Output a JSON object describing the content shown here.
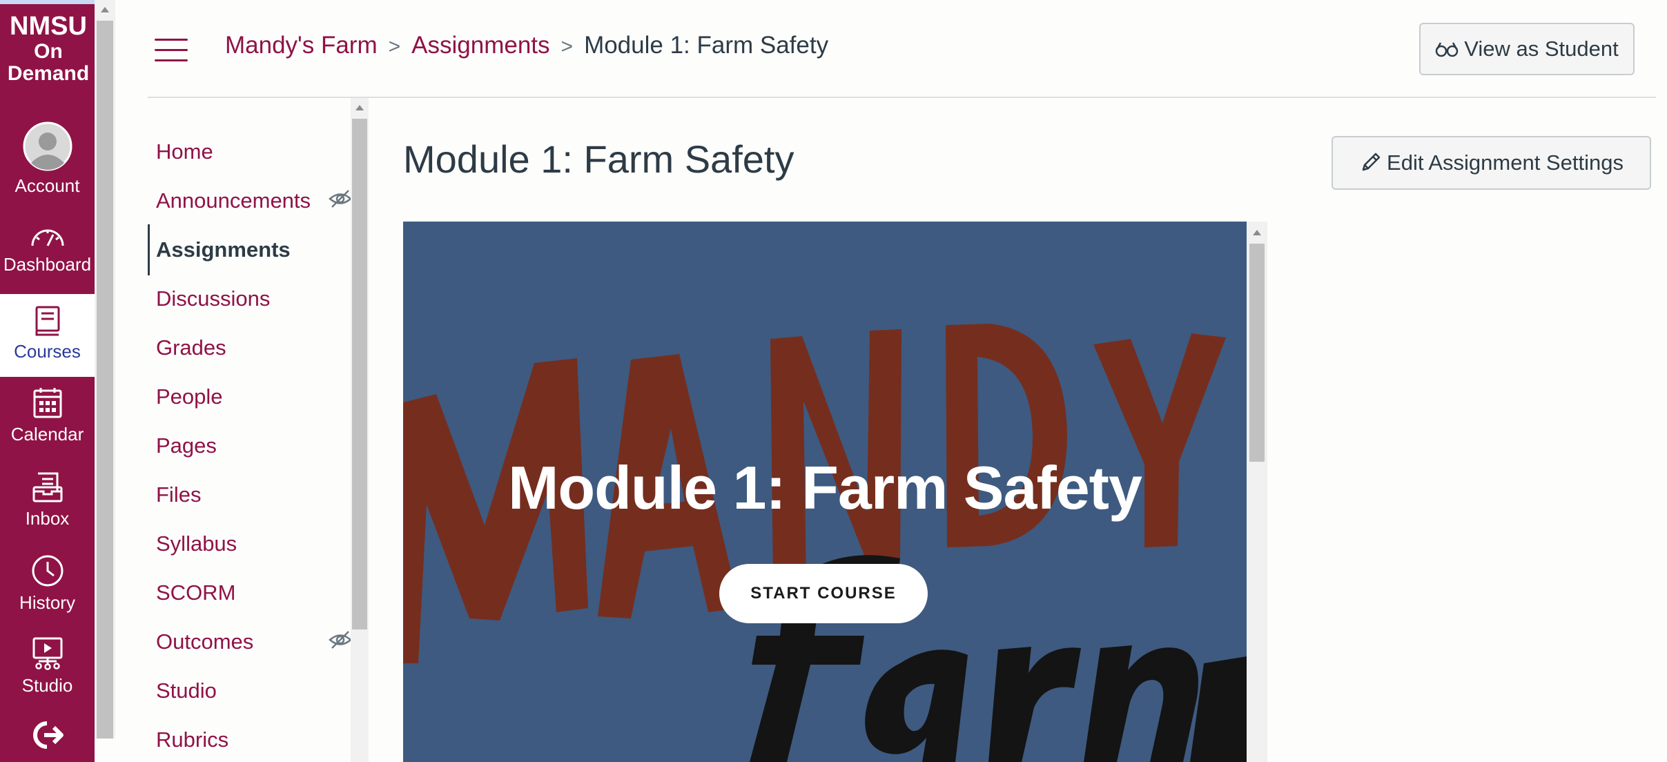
{
  "global_nav": {
    "brand": {
      "line1": "NMSU",
      "line2": "On",
      "line3": "Demand"
    },
    "items": [
      {
        "label": "Account",
        "icon": "avatar-icon"
      },
      {
        "label": "Dashboard",
        "icon": "dashboard-icon"
      },
      {
        "label": "Courses",
        "icon": "courses-icon",
        "active": true
      },
      {
        "label": "Calendar",
        "icon": "calendar-icon"
      },
      {
        "label": "Inbox",
        "icon": "inbox-icon"
      },
      {
        "label": "History",
        "icon": "history-icon"
      },
      {
        "label": "Studio",
        "icon": "studio-icon"
      },
      {
        "label": "",
        "icon": "logout-icon"
      }
    ]
  },
  "header": {
    "breadcrumbs": [
      "Mandy's Farm",
      "Assignments",
      "Module 1: Farm Safety"
    ],
    "view_as_student": "View as Student"
  },
  "course_nav": {
    "items": [
      {
        "label": "Home"
      },
      {
        "label": "Announcements",
        "hidden_icon": true
      },
      {
        "label": "Assignments",
        "active": true
      },
      {
        "label": "Discussions"
      },
      {
        "label": "Grades"
      },
      {
        "label": "People"
      },
      {
        "label": "Pages"
      },
      {
        "label": "Files"
      },
      {
        "label": "Syllabus"
      },
      {
        "label": "SCORM"
      },
      {
        "label": "Outcomes",
        "hidden_icon": true
      },
      {
        "label": "Studio"
      },
      {
        "label": "Rubrics"
      }
    ]
  },
  "main": {
    "title": "Module 1: Farm Safety",
    "edit_button": "Edit Assignment Settings",
    "banner": {
      "title": "Module 1: Farm Safety",
      "start_button": "START COURSE"
    }
  },
  "colors": {
    "brand": "#8f1346",
    "text": "#2d3b45",
    "banner_bg": "#3e5a80",
    "banner_red": "#7a2a16"
  }
}
